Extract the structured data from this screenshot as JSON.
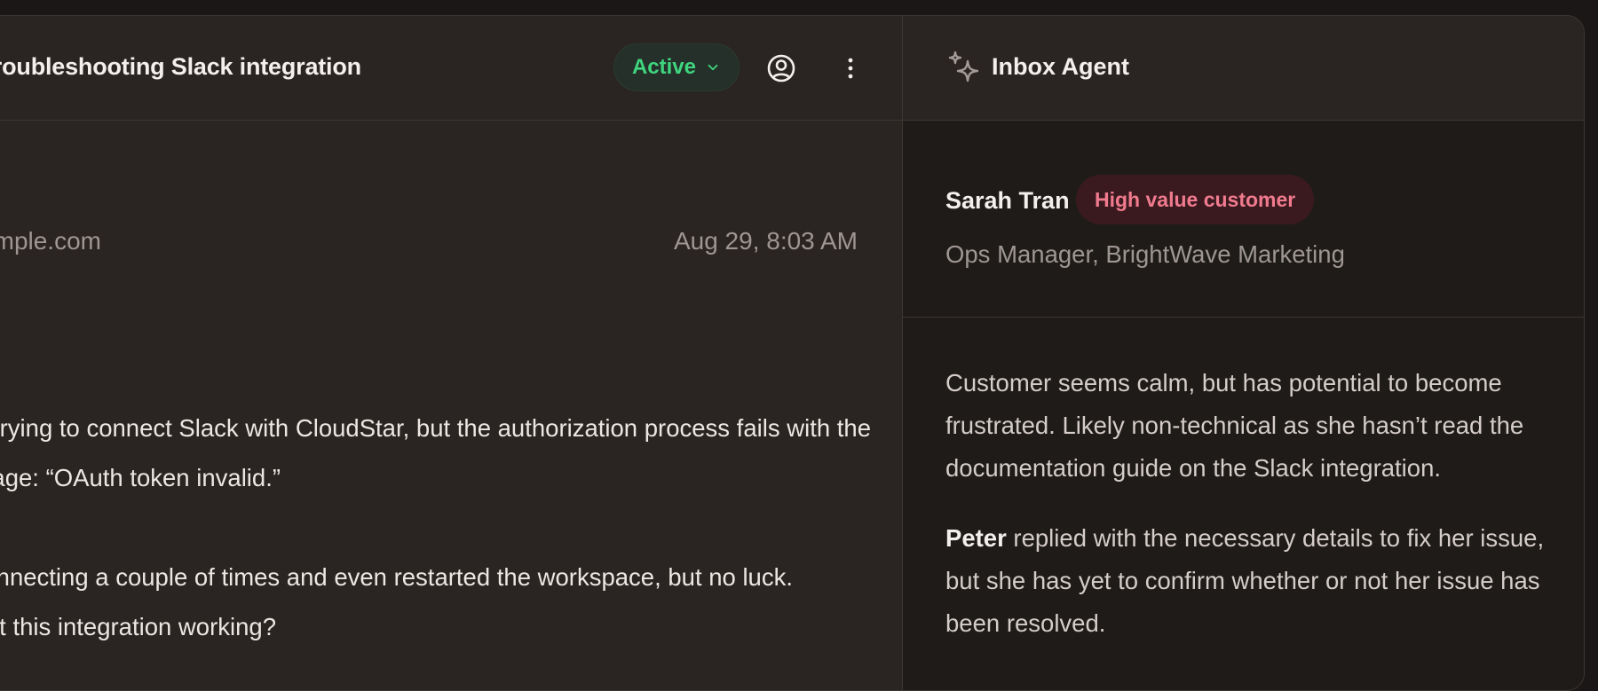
{
  "conversation": {
    "title": "Troubleshooting Slack integration",
    "status": "Active",
    "sender_email": "sarah.tran@example.com",
    "timestamp": "Aug 29, 8:03 AM",
    "body_lines": [
      "I’m trying to connect Slack with CloudStar, but the authorization process fails with the",
      "error message: “OAuth token invalid.”",
      "I’ve tried reconnecting a couple of times and even restarted the workspace, but no luck.",
      "How can I get this integration working?"
    ]
  },
  "agent_panel": {
    "title": "Inbox Agent",
    "customer": {
      "name": "Sarah Tran",
      "badge": "High value customer",
      "role": "Ops Manager, BrightWave Marketing"
    },
    "summary_1": "Customer seems calm, but has potential to become frustrated. Likely non-technical as she hasn’t read the documentation guide on the Slack integration.",
    "summary_2_name": "Peter",
    "summary_2_text": " replied with the necessary details to fix her issue, but she has yet to confirm whether or not her issue has been resolved."
  },
  "colors": {
    "status_green": "#3fd57e",
    "badge_pink": "#f07a8e",
    "panel_bg": "#2a2522"
  },
  "icons": {
    "status_dropdown": "chevron-down-icon",
    "user": "user-circle-icon",
    "more": "more-vertical-icon",
    "agent": "sparkles-icon"
  }
}
